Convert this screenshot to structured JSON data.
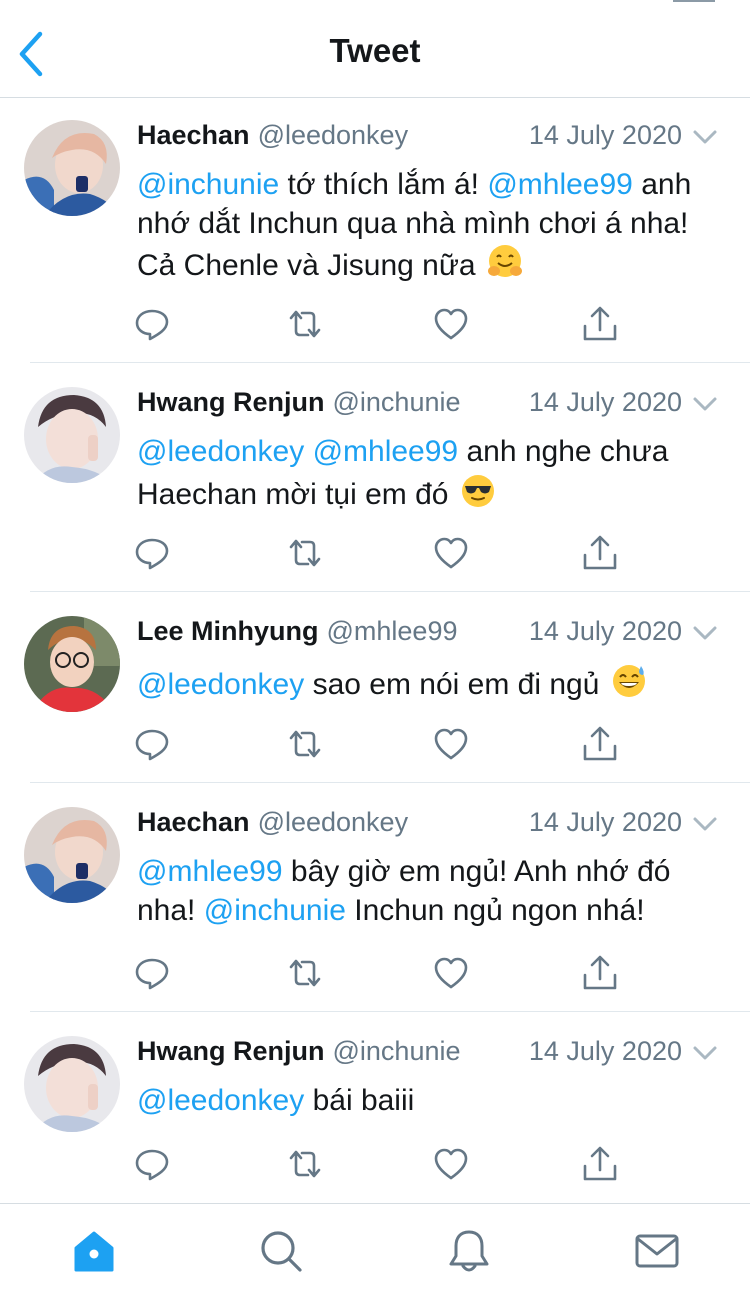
{
  "header": {
    "title": "Tweet",
    "back_icon": "chevron-left-icon"
  },
  "colors": {
    "accent": "#1da1f2",
    "text": "#14171a",
    "secondary": "#657786",
    "divider": "#e1e8ed",
    "icon": "#657786"
  },
  "tweets": [
    {
      "name": "Haechan",
      "handle": "@leedonkey",
      "date": "14 July 2020",
      "segments": [
        {
          "type": "mention",
          "text": "@inchunie"
        },
        {
          "type": "text",
          "text": " tớ thích lắm á! "
        },
        {
          "type": "mention",
          "text": "@mhlee99"
        },
        {
          "type": "text",
          "text": " anh nhớ dắt Inchun qua nhà mình chơi á nha! Cả Chenle và Jisung nữa "
        },
        {
          "type": "emoji",
          "name": "hugging-face-emoji"
        }
      ]
    },
    {
      "name": "Hwang Renjun",
      "handle": "@inchunie",
      "date": "14 July 2020",
      "segments": [
        {
          "type": "mention",
          "text": "@leedonkey"
        },
        {
          "type": "text",
          "text": " "
        },
        {
          "type": "mention",
          "text": "@mhlee99"
        },
        {
          "type": "text",
          "text": " anh nghe chưa Haechan mời tụi em đó "
        },
        {
          "type": "emoji",
          "name": "sunglasses-face-emoji"
        }
      ]
    },
    {
      "name": "Lee Minhyung",
      "handle": "@mhlee99",
      "date": "14 July 2020",
      "segments": [
        {
          "type": "mention",
          "text": "@leedonkey"
        },
        {
          "type": "text",
          "text": " sao em nói em đi ngủ "
        },
        {
          "type": "emoji",
          "name": "grinning-sweat-emoji"
        }
      ]
    },
    {
      "name": "Haechan",
      "handle": "@leedonkey",
      "date": "14 July 2020",
      "segments": [
        {
          "type": "mention",
          "text": "@mhlee99"
        },
        {
          "type": "text",
          "text": " bây giờ em ngủ! Anh nhớ đó nha! "
        },
        {
          "type": "mention",
          "text": "@inchunie"
        },
        {
          "type": "text",
          "text": " Inchun ngủ ngon nhá!"
        }
      ]
    },
    {
      "name": "Hwang Renjun",
      "handle": "@inchunie",
      "date": "14 July 2020",
      "segments": [
        {
          "type": "mention",
          "text": "@leedonkey"
        },
        {
          "type": "text",
          "text": " bái baiii"
        }
      ]
    }
  ],
  "actions": [
    "reply-icon",
    "retweet-icon",
    "like-icon",
    "share-icon"
  ],
  "tabbar": [
    {
      "icon": "home-icon",
      "active": true
    },
    {
      "icon": "search-icon",
      "active": false
    },
    {
      "icon": "notifications-icon",
      "active": false
    },
    {
      "icon": "messages-icon",
      "active": false
    }
  ]
}
